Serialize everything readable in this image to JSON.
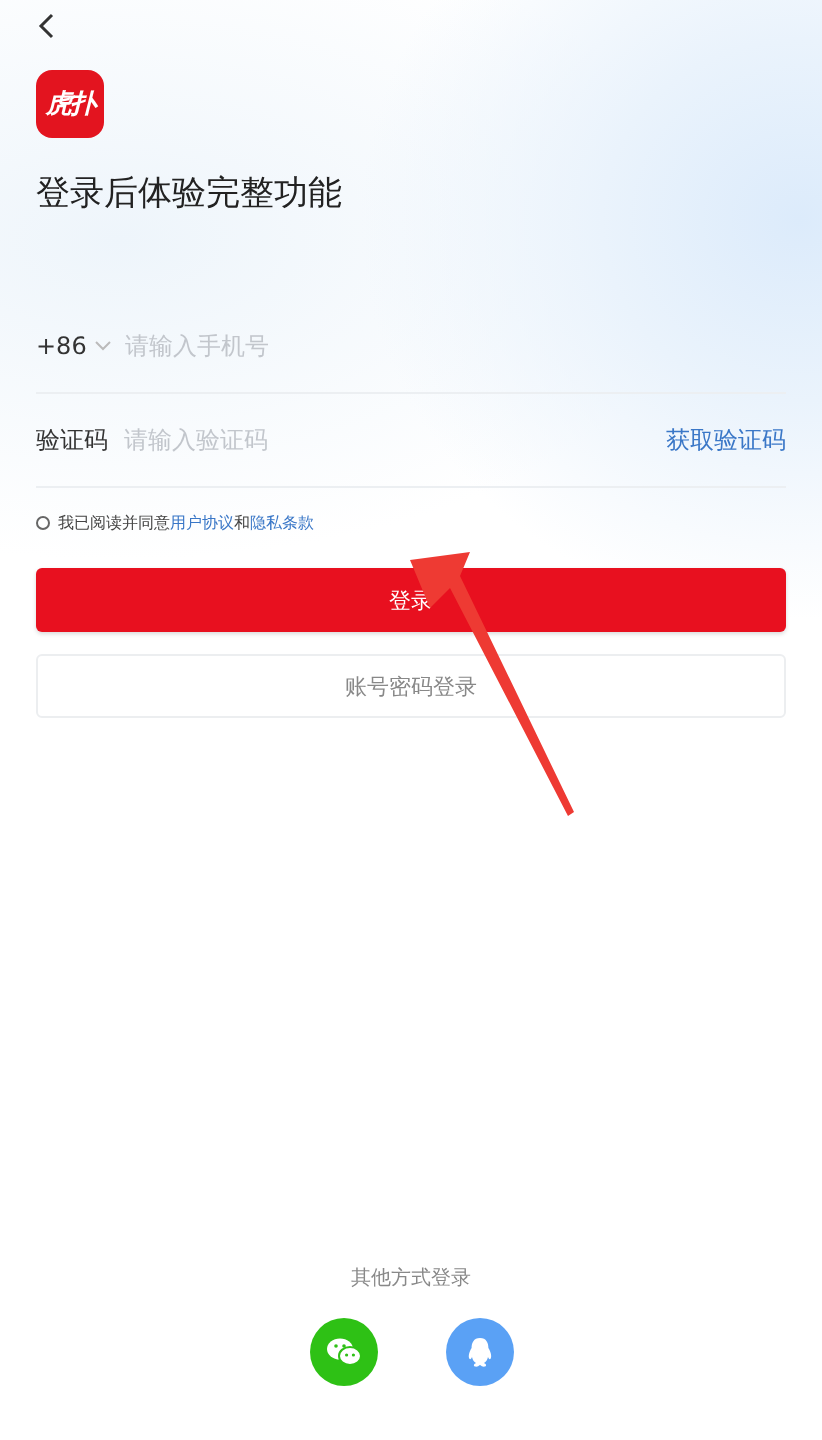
{
  "logo_text": "虎扑",
  "title": "登录后体验完整功能",
  "phone": {
    "country_code": "+86",
    "placeholder": "请输入手机号"
  },
  "code": {
    "label": "验证码",
    "placeholder": "请输入验证码",
    "action": "获取验证码"
  },
  "agreement": {
    "checked": false,
    "prefix": "我已阅读并同意",
    "link_1": "用户协议",
    "middle": "和",
    "link_2": "隐私条款"
  },
  "login_button": "登录",
  "password_login_button": "账号密码登录",
  "other_login": {
    "label": "其他方式登录",
    "options": [
      {
        "kind": "wechat"
      },
      {
        "kind": "qq"
      }
    ]
  }
}
